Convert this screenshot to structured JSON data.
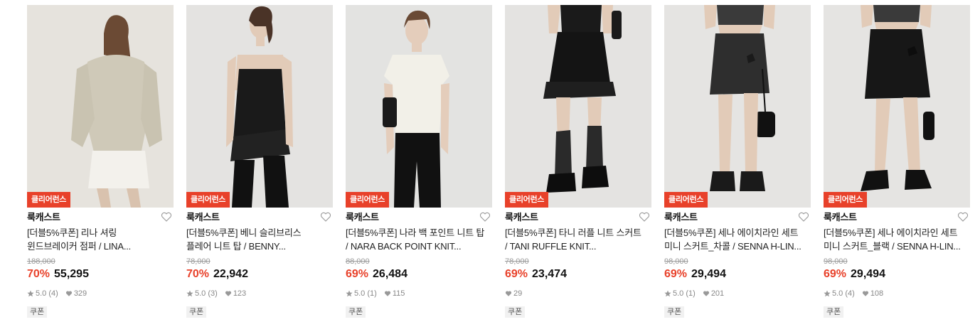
{
  "products": [
    {
      "badge": "클리어런스",
      "brand": "룩캐스트",
      "name_line1": "[더블5%쿠폰] 리나 셔링",
      "name_line2": "윈드브레이커 점퍼 / LINA...",
      "original_price": "188,000",
      "discount": "70%",
      "price": "55,295",
      "rating": "5.0",
      "review_count": "(4)",
      "likes": "329",
      "tag": "쿠폰",
      "image_icon": "model-beige-jacket-photo"
    },
    {
      "badge": "클리어런스",
      "brand": "룩캐스트",
      "name_line1": "[더블5%쿠폰] 베니 슬리브리스",
      "name_line2": "플레어 니트 탑 / BENNY...",
      "original_price": "78,000",
      "discount": "70%",
      "price": "22,942",
      "rating": "5.0",
      "review_count": "(3)",
      "likes": "123",
      "tag": "쿠폰",
      "image_icon": "model-black-sleeveless-top-photo"
    },
    {
      "badge": "클리어런스",
      "brand": "룩캐스트",
      "name_line1": "[더블5%쿠폰] 나라 백 포인트 니트 탑",
      "name_line2": "/ NARA BACK POINT KNIT...",
      "original_price": "88,000",
      "discount": "69%",
      "price": "26,484",
      "rating": "5.0",
      "review_count": "(1)",
      "likes": "115",
      "tag": "쿠폰",
      "image_icon": "model-white-knit-top-photo"
    },
    {
      "badge": "클리어런스",
      "brand": "룩캐스트",
      "name_line1": "[더블5%쿠폰] 타니 러플 니트 스커트",
      "name_line2": "/ TANI RUFFLE KNIT...",
      "original_price": "78,000",
      "discount": "69%",
      "price": "23,474",
      "rating": "",
      "review_count": "",
      "likes": "29",
      "tag": "쿠폰",
      "image_icon": "model-black-ruffle-skirt-photo"
    },
    {
      "badge": "클리어런스",
      "brand": "룩캐스트",
      "name_line1": "[더블5%쿠폰] 세나 에이치라인 세트",
      "name_line2": "미니 스커트_차콜 / SENNA H-LIN...",
      "original_price": "98,000",
      "discount": "69%",
      "price": "29,494",
      "rating": "5.0",
      "review_count": "(1)",
      "likes": "201",
      "tag": "쿠폰",
      "image_icon": "model-charcoal-mini-skirt-photo"
    },
    {
      "badge": "클리어런스",
      "brand": "룩캐스트",
      "name_line1": "[더블5%쿠폰] 세나 에이치라인 세트",
      "name_line2": "미니 스커트_블랙 / SENNA H-LIN...",
      "original_price": "98,000",
      "discount": "69%",
      "price": "29,494",
      "rating": "5.0",
      "review_count": "(4)",
      "likes": "108",
      "tag": "쿠폰",
      "image_icon": "model-black-mini-skirt-photo"
    }
  ],
  "colors": {
    "accent": "#e8412a",
    "strike": "#9a9a9a",
    "meta": "#888888"
  }
}
